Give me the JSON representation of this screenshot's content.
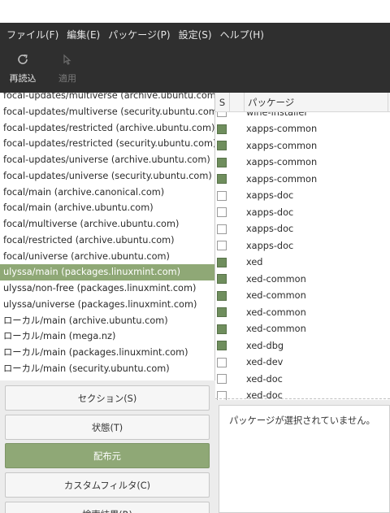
{
  "menubar": {
    "items": [
      "ファイル(F)",
      "編集(E)",
      "パッケージ(P)",
      "設定(S)",
      "ヘルプ(H)"
    ]
  },
  "toolbar": {
    "reload": {
      "label": "再読込",
      "icon": "reload-icon",
      "enabled": true
    },
    "apply": {
      "label": "適用",
      "icon": "apply-icon",
      "enabled": false
    }
  },
  "filters": {
    "items": [
      "focal-updates/multiverse (archive.ubuntu.com)",
      "focal-updates/multiverse (security.ubuntu.com)",
      "focal-updates/restricted (archive.ubuntu.com)",
      "focal-updates/restricted (security.ubuntu.com)",
      "focal-updates/universe (archive.ubuntu.com)",
      "focal-updates/universe (security.ubuntu.com)",
      "focal/main (archive.canonical.com)",
      "focal/main (archive.ubuntu.com)",
      "focal/multiverse (archive.ubuntu.com)",
      "focal/restricted (archive.ubuntu.com)",
      "focal/universe (archive.ubuntu.com)",
      "ulyssa/main (packages.linuxmint.com)",
      "ulyssa/non-free (packages.linuxmint.com)",
      "ulyssa/universe (packages.linuxmint.com)",
      "ローカル/main (archive.ubuntu.com)",
      "ローカル/main (mega.nz)",
      "ローカル/main (packages.linuxmint.com)",
      "ローカル/main (security.ubuntu.com)"
    ],
    "selected_index": 11
  },
  "packages": {
    "header": {
      "status": "S",
      "name": "パッケージ"
    },
    "rows": [
      {
        "name": "wine-installer",
        "installed": false
      },
      {
        "name": "xapps-common",
        "installed": true
      },
      {
        "name": "xapps-common",
        "installed": true
      },
      {
        "name": "xapps-common",
        "installed": true
      },
      {
        "name": "xapps-common",
        "installed": true
      },
      {
        "name": "xapps-doc",
        "installed": false
      },
      {
        "name": "xapps-doc",
        "installed": false
      },
      {
        "name": "xapps-doc",
        "installed": false
      },
      {
        "name": "xapps-doc",
        "installed": false
      },
      {
        "name": "xed",
        "installed": true
      },
      {
        "name": "xed-common",
        "installed": true
      },
      {
        "name": "xed-common",
        "installed": true
      },
      {
        "name": "xed-common",
        "installed": true
      },
      {
        "name": "xed-common",
        "installed": true
      },
      {
        "name": "xed-dbg",
        "installed": true
      },
      {
        "name": "xed-dev",
        "installed": false
      },
      {
        "name": "xed-doc",
        "installed": false
      },
      {
        "name": "xed-doc",
        "installed": false
      }
    ]
  },
  "category_buttons": [
    {
      "label": "セクション(S)",
      "active": false
    },
    {
      "label": "状態(T)",
      "active": false
    },
    {
      "label": "配布元",
      "active": true
    },
    {
      "label": "カスタムフィルタ(C)",
      "active": false
    },
    {
      "label": "検索結果(R)",
      "active": false
    }
  ],
  "description": {
    "text": "パッケージが選択されていません。"
  },
  "colors": {
    "accent": "#8fa876",
    "installed_checkbox": "#6f8e5d",
    "chrome": "#2f2f2f"
  }
}
